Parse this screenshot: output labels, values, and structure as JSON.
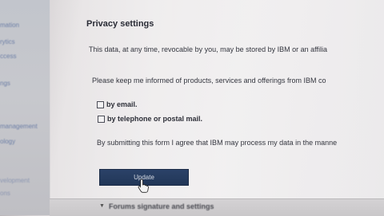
{
  "sidebar": {
    "items": [
      {
        "label": "mation"
      },
      {
        "label": "rytics"
      },
      {
        "label": "ccess"
      },
      {
        "label": "ngs"
      },
      {
        "label": "management"
      },
      {
        "label": "ology"
      },
      {
        "label": "velopment"
      },
      {
        "label": "ons"
      }
    ]
  },
  "privacy": {
    "heading": "Privacy settings",
    "data_notice": "This data, at any time, revocable by you, may be stored by IBM or an affilia",
    "inform_prompt": "Please keep me informed of products, services and offerings from IBM co",
    "options": [
      {
        "label": "by email.",
        "checked": false
      },
      {
        "label": "by telephone or postal mail.",
        "checked": false
      }
    ],
    "consent_text": "By submitting this form I agree that IBM may process my data in the manne"
  },
  "actions": {
    "update_label": "Update"
  },
  "accordion": {
    "label": "Forums signature and settings"
  },
  "colors": {
    "button": "#213657",
    "sidebar_link": "#6d7fa6"
  }
}
